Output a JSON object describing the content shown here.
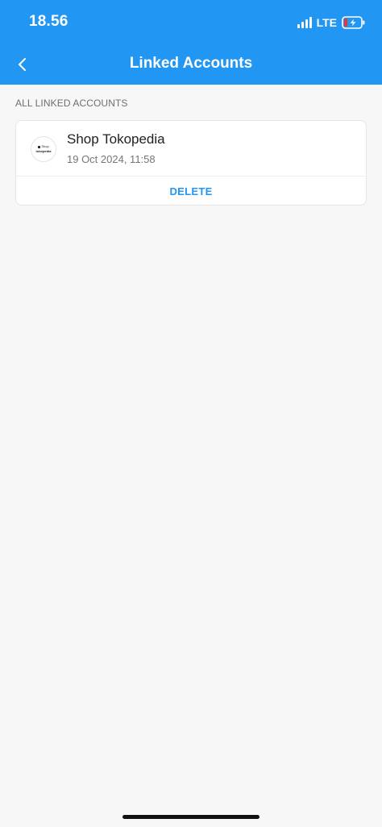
{
  "status_bar": {
    "time": "18.56",
    "network": "LTE",
    "icons": [
      "signal-icon",
      "battery-charging-icon"
    ]
  },
  "header": {
    "title": "Linked Accounts",
    "back_icon": "chevron-left-icon",
    "background_color": "#2196f3"
  },
  "section": {
    "title": "ALL LINKED ACCOUNTS"
  },
  "accounts": [
    {
      "name": "Shop Tokopedia",
      "linked_at": "19 Oct 2024, 11:58",
      "logo_top": "Shop",
      "logo_bottom": "tokopedia",
      "delete_label": "DELETE"
    }
  ],
  "colors": {
    "accent": "#2196f3",
    "battery_low": "#e53935"
  }
}
